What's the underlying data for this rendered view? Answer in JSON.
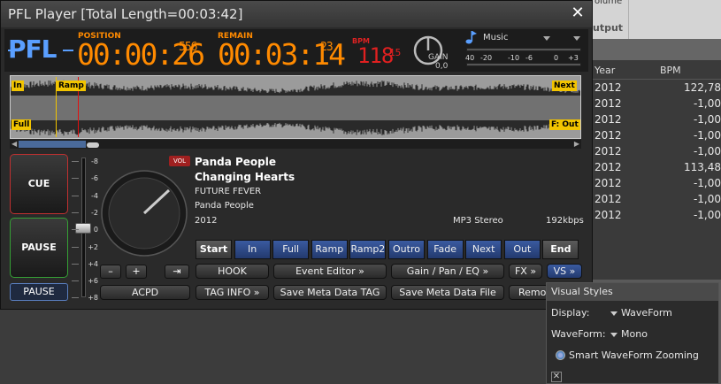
{
  "window": {
    "title": "PFL Player [Total Length=00:03:42]",
    "close_icon": "close-icon"
  },
  "header": {
    "pfl_label": "PFL",
    "position_label": "POSITION",
    "position_time": "00:00:26",
    "position_ms": "556",
    "remain_label": "REMAIN",
    "remain_time": "00:03:14",
    "remain_ms": "23",
    "bpm_label": "BPM",
    "bpm_value": "118",
    "bpm_decimal": "15",
    "gain_label": "GAIN",
    "gain_value": "0,0",
    "music_label": "Music",
    "vu_scale": [
      "40",
      "-20",
      "-10",
      "-6",
      "0",
      "+3"
    ]
  },
  "waveform": {
    "cue_in": "In",
    "cue_ramp": "Ramp",
    "cue_full": "Full",
    "cue_next": "Next",
    "cue_fout": "F: Out"
  },
  "left": {
    "cue_label": "CUE",
    "pause_label": "PAUSE",
    "pause_small_label": "PAUSE",
    "minus_label": "–",
    "plus_label": "+",
    "pitch_scale": [
      "-8",
      "-6",
      "-4",
      "-2",
      "0",
      "+2",
      "+4",
      "+6",
      "+8"
    ]
  },
  "track": {
    "vol_label": "VOL",
    "artist": "Panda People",
    "title": "Changing Hearts",
    "album": "FUTURE FEVER",
    "album_artist": "Panda People",
    "year": "2012",
    "format": "MP3 Stereo",
    "bitrate": "192kbps"
  },
  "cue_buttons": [
    "Start",
    "In",
    "Full",
    "Ramp",
    "Ramp2",
    "Outro",
    "Fade",
    "Next",
    "Out",
    "End"
  ],
  "function_buttons": {
    "hook": "HOOK",
    "event_editor": "Event Editor »",
    "gain_pan_eq": "Gain / Pan / EQ »",
    "fx": "FX »",
    "vs": "VS »",
    "acpd": "ACPD",
    "tag_info": "TAG INFO »",
    "save_meta_tag": "Save Meta Data TAG",
    "save_meta_file": "Save Meta Data File",
    "remove": "Remov"
  },
  "visual_styles": {
    "title": "Visual Styles",
    "display_label": "Display:",
    "display_value": "WaveForm",
    "waveform_label": "WaveForm:",
    "waveform_value": "Mono",
    "smart_zoom": "Smart WaveForm Zooming",
    "close": "✕"
  },
  "background_app": {
    "top_label": "olume",
    "output_label": "utput",
    "col_year": "Year",
    "col_bpm": "BPM",
    "rows": [
      {
        "year": "2012",
        "bpm": "122,78"
      },
      {
        "year": "2012",
        "bpm": "-1,00"
      },
      {
        "year": "2012",
        "bpm": "-1,00"
      },
      {
        "year": "2012",
        "bpm": "-1,00"
      },
      {
        "year": "2012",
        "bpm": "-1,00"
      },
      {
        "year": "2012",
        "bpm": "113,48"
      },
      {
        "year": "2012",
        "bpm": "-1,00"
      },
      {
        "year": "2012",
        "bpm": "-1,00"
      },
      {
        "year": "2012",
        "bpm": "-1,00"
      }
    ]
  },
  "colors": {
    "accent_blue": "#5a9fff",
    "lcd_orange": "#ff8a00",
    "bpm_red": "#e02020",
    "cue_yellow": "#f2c400"
  }
}
